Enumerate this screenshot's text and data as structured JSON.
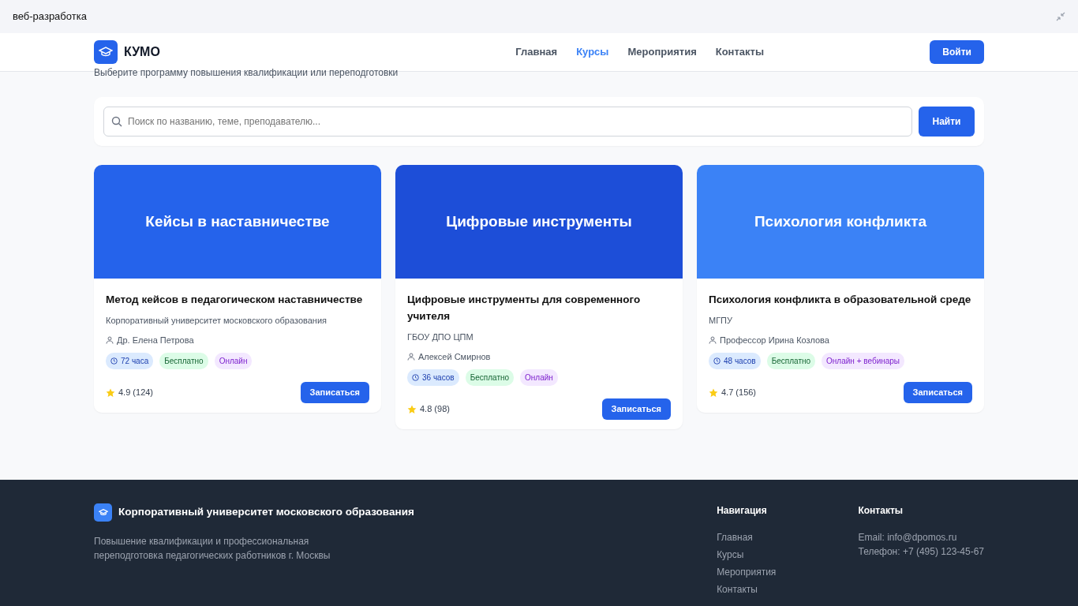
{
  "window": {
    "title": "веб-разработка"
  },
  "navbar": {
    "brand": "КУМО",
    "items": [
      {
        "label": "Главная",
        "selected": false
      },
      {
        "label": "Курсы",
        "selected": true
      },
      {
        "label": "Мероприятия",
        "selected": false
      },
      {
        "label": "Контакты",
        "selected": false
      }
    ],
    "login": "Войти"
  },
  "subtitle": "Выберите программу повышения квалификации или переподготовки",
  "search": {
    "placeholder": "Поиск по названию, теме, преподавателю...",
    "button": "Найти"
  },
  "courses": [
    {
      "banner": "Кейсы в наставничестве",
      "color": "#2563eb",
      "title": "Метод кейсов в педагогическом наставничестве",
      "provider": "Корпоративный университет московского образования",
      "teacher": "Др. Елена Петрова",
      "tags": [
        {
          "kind": "duration",
          "label": "72 часа"
        },
        {
          "kind": "price",
          "label": "Бесплатно"
        },
        {
          "kind": "format",
          "label": "Онлайн"
        }
      ],
      "rating": "4.9 (124)",
      "button": "Записаться"
    },
    {
      "banner": "Цифровые инструменты",
      "color": "#1d4ed8",
      "title": "Цифровые инструменты для современного учителя",
      "provider": "ГБОУ ДПО ЦПМ",
      "teacher": "Алексей Смирнов",
      "tags": [
        {
          "kind": "duration",
          "label": "36 часов"
        },
        {
          "kind": "price",
          "label": "Бесплатно"
        },
        {
          "kind": "format",
          "label": "Онлайн"
        }
      ],
      "rating": "4.8 (98)",
      "button": "Записаться"
    },
    {
      "banner": "Психология конфликта",
      "color": "#3b82f6",
      "title": "Психология конфликта в образовательной среде",
      "provider": "МГПУ",
      "teacher": "Профессор Ирина Козлова",
      "tags": [
        {
          "kind": "duration",
          "label": "48 часов"
        },
        {
          "kind": "price",
          "label": "Бесплатно"
        },
        {
          "kind": "format",
          "label": "Онлайн + вебинары"
        }
      ],
      "rating": "4.7 (156)",
      "button": "Записаться"
    }
  ],
  "footer": {
    "org": "Корпоративный университет московского образования",
    "description_lines": [
      "Повышение квалификации и профессиональная",
      "переподготовка педагогических работников г. Москвы"
    ],
    "nav_title": "Навигация",
    "nav_links": [
      "Главная",
      "Курсы",
      "Мероприятия",
      "Контакты"
    ],
    "contacts_title": "Контакты",
    "contacts": [
      "Email: info@dpomos.ru",
      "Телефон: +7 (495) 123-45-67"
    ]
  }
}
